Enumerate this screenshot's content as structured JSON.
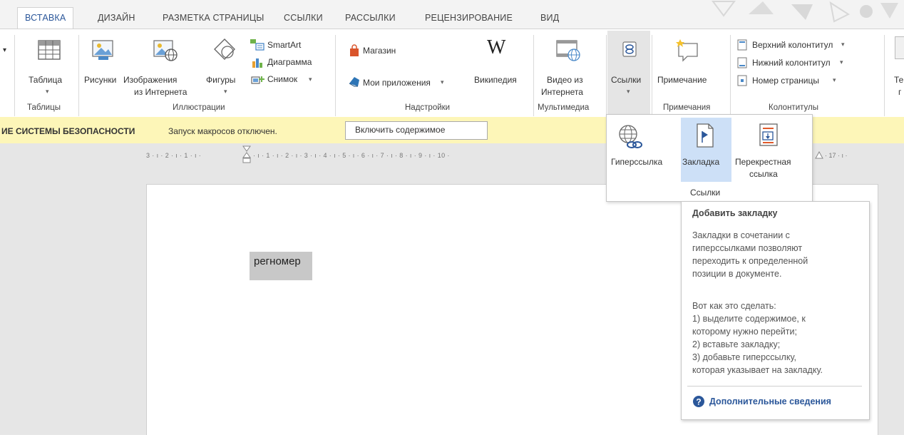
{
  "tabs": [
    "ВСТАВКА",
    "ДИЗАЙН",
    "РАЗМЕТКА СТРАНИЦЫ",
    "ССЫЛКИ",
    "РАССЫЛКИ",
    "РЕЦЕНЗИРОВАНИЕ",
    "ВИД"
  ],
  "ribbon": {
    "table": {
      "label": "Таблица",
      "group": "Таблицы"
    },
    "illustrations": {
      "pictures": "Рисунки",
      "online_pictures_1": "Изображения",
      "online_pictures_2": "из Интернета",
      "shapes": "Фигуры",
      "smartart": "SmartArt",
      "chart": "Диаграмма",
      "screenshot": "Снимок",
      "group": "Иллюстрации"
    },
    "addins": {
      "store": "Магазин",
      "my_apps": "Мои приложения",
      "wikipedia": "Википедия",
      "wiki_glyph": "W",
      "group": "Надстройки"
    },
    "media": {
      "video_1": "Видео из",
      "video_2": "Интернета",
      "group": "Мультимедиа"
    },
    "links": {
      "label": "Ссылки"
    },
    "comments": {
      "label": "Примечание",
      "group": "Примечания"
    },
    "header_footer": {
      "header": "Верхний колонтитул",
      "footer": "Нижний колонтитул",
      "page_number": "Номер страницы",
      "group": "Колонтитулы"
    },
    "text_partial_1": "Те",
    "text_partial_2": "г"
  },
  "security_bar": {
    "title": "ИЕ СИСТЕМЫ БЕЗОПАСНОСТИ",
    "message": "Запуск макросов отключен.",
    "button": "Включить содержимое"
  },
  "ruler": {
    "left": "3 · ı · 2 · ı · 1 · ı ·",
    "right": "· ı · 1 · ı · 2 · ı · 3 · ı · 4 · ı · 5 · ı · 6 · ı · 7 · ı · 8 · ı · 9 · ı · 10 ·",
    "far": "· 17 · ı ·"
  },
  "document": {
    "selected_text": "регномер"
  },
  "links_dropdown": {
    "hyperlink": "Гиперссылка",
    "bookmark": "Закладка",
    "crossref_1": "Перекрестная",
    "crossref_2": "ссылка",
    "group": "Ссылки"
  },
  "tooltip": {
    "title": "Добавить закладку",
    "desc": [
      "Закладки в сочетании с",
      "гиперссылками позволяют",
      "переходить к определенной",
      "позиции в документе."
    ],
    "how_title": "Вот как это сделать:",
    "steps": [
      "1) выделите содержимое, к",
      "которому нужно перейти;",
      "2) вставьте закладку;",
      "3) добавьте гиперссылку,",
      "которая указывает на закладку."
    ],
    "more": "Дополнительные сведения"
  },
  "colors": {
    "accent": "#2b579a",
    "security_bar": "#fdf6b8",
    "bookmark_highlight": "#cde0f7"
  }
}
